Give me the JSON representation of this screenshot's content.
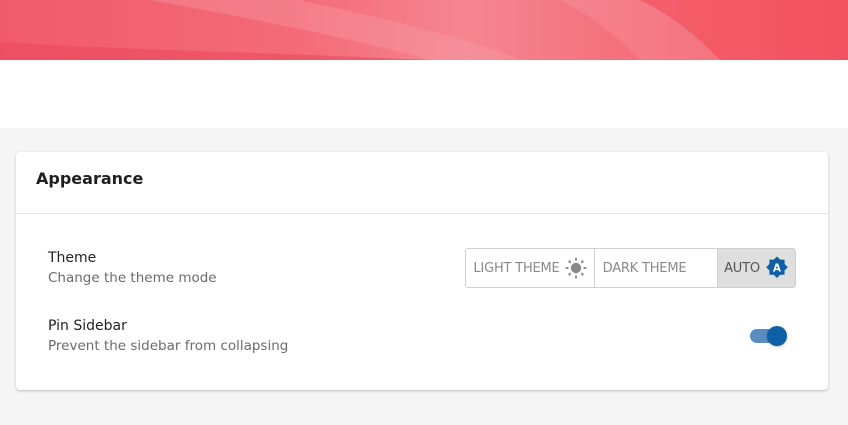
{
  "card": {
    "title": "Appearance"
  },
  "settings": {
    "theme": {
      "title": "Theme",
      "description": "Change the theme mode",
      "options": [
        {
          "label": "LIGHT THEME",
          "icon": "sun-icon",
          "selected": false
        },
        {
          "label": "DARK THEME",
          "icon": "moon-icon",
          "selected": false
        },
        {
          "label": "AUTO",
          "icon": "auto-brightness-icon",
          "selected": true
        }
      ]
    },
    "pin_sidebar": {
      "title": "Pin Sidebar",
      "description": "Prevent the sidebar from collapsing",
      "enabled": true
    }
  },
  "colors": {
    "banner": "#f15a6b",
    "accent": "#0d5fa6",
    "toggle_track": "#5b8cc0"
  }
}
